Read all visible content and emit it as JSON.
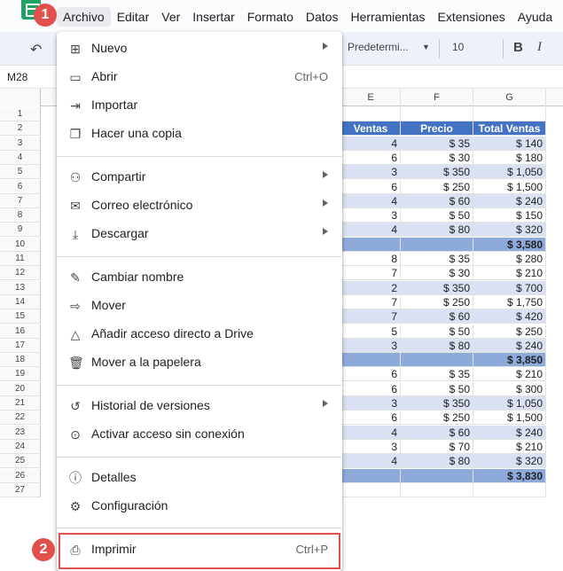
{
  "menubar": {
    "items": [
      "Archivo",
      "Editar",
      "Ver",
      "Insertar",
      "Formato",
      "Datos",
      "Herramientas",
      "Extensiones",
      "Ayuda"
    ]
  },
  "toolbar": {
    "font": "Predetermi...",
    "size": "10",
    "bold": "B",
    "italic": "I"
  },
  "formula_bar": {
    "cell_ref": "M28"
  },
  "grid": {
    "columns": [
      "E",
      "F",
      "G"
    ],
    "header": [
      "Ventas",
      "Precio",
      "Total Ventas"
    ],
    "rows": [
      {
        "n": "1",
        "e": "",
        "f": "",
        "g": "",
        "kind": "blank"
      },
      {
        "n": "2",
        "e": "Ventas",
        "f": "Precio",
        "g": "Total Ventas",
        "kind": "header"
      },
      {
        "n": "3",
        "e": "4",
        "f": "$ 35",
        "g": "$ 140",
        "kind": "band"
      },
      {
        "n": "4",
        "e": "6",
        "f": "$ 30",
        "g": "$ 180",
        "kind": "plain"
      },
      {
        "n": "5",
        "e": "3",
        "f": "$ 350",
        "g": "$ 1,050",
        "kind": "band"
      },
      {
        "n": "6",
        "e": "6",
        "f": "$ 250",
        "g": "$ 1,500",
        "kind": "plain"
      },
      {
        "n": "7",
        "e": "4",
        "f": "$ 60",
        "g": "$ 240",
        "kind": "band"
      },
      {
        "n": "8",
        "e": "3",
        "f": "$ 50",
        "g": "$ 150",
        "kind": "plain"
      },
      {
        "n": "9",
        "e": "4",
        "f": "$ 80",
        "g": "$ 320",
        "kind": "band"
      },
      {
        "n": "10",
        "e": "",
        "f": "",
        "g": "$ 3,580",
        "kind": "total"
      },
      {
        "n": "11",
        "e": "8",
        "f": "$ 35",
        "g": "$ 280",
        "kind": "plain"
      },
      {
        "n": "12",
        "e": "7",
        "f": "$ 30",
        "g": "$ 210",
        "kind": "plain"
      },
      {
        "n": "13",
        "e": "2",
        "f": "$ 350",
        "g": "$ 700",
        "kind": "band"
      },
      {
        "n": "14",
        "e": "7",
        "f": "$ 250",
        "g": "$ 1,750",
        "kind": "plain"
      },
      {
        "n": "15",
        "e": "7",
        "f": "$ 60",
        "g": "$ 420",
        "kind": "band"
      },
      {
        "n": "16",
        "e": "5",
        "f": "$ 50",
        "g": "$ 250",
        "kind": "plain"
      },
      {
        "n": "17",
        "e": "3",
        "f": "$ 80",
        "g": "$ 240",
        "kind": "band"
      },
      {
        "n": "18",
        "e": "",
        "f": "",
        "g": "$ 3,850",
        "kind": "total"
      },
      {
        "n": "19",
        "e": "6",
        "f": "$ 35",
        "g": "$ 210",
        "kind": "plain"
      },
      {
        "n": "20",
        "e": "6",
        "f": "$ 50",
        "g": "$ 300",
        "kind": "plain"
      },
      {
        "n": "21",
        "e": "3",
        "f": "$ 350",
        "g": "$ 1,050",
        "kind": "band"
      },
      {
        "n": "22",
        "e": "6",
        "f": "$ 250",
        "g": "$ 1,500",
        "kind": "plain"
      },
      {
        "n": "23",
        "e": "4",
        "f": "$ 60",
        "g": "$ 240",
        "kind": "band"
      },
      {
        "n": "24",
        "e": "3",
        "f": "$ 70",
        "g": "$ 210",
        "kind": "plain"
      },
      {
        "n": "25",
        "e": "4",
        "f": "$ 80",
        "g": "$ 320",
        "kind": "band"
      },
      {
        "n": "26",
        "e": "",
        "f": "",
        "g": "$ 3,830",
        "kind": "total"
      },
      {
        "n": "27",
        "e": "",
        "f": "",
        "g": "",
        "kind": "blank"
      }
    ]
  },
  "dropdown": {
    "items": [
      {
        "label": "Nuevo",
        "icon": "plus-square-icon",
        "glyph": "⊞",
        "submenu": true,
        "shortcut": ""
      },
      {
        "label": "Abrir",
        "icon": "folder-icon",
        "glyph": "▭",
        "submenu": false,
        "shortcut": "Ctrl+O"
      },
      {
        "label": "Importar",
        "icon": "import-icon",
        "glyph": "⇥",
        "submenu": false,
        "shortcut": ""
      },
      {
        "label": "Hacer una copia",
        "icon": "copy-icon",
        "glyph": "❐",
        "submenu": false,
        "shortcut": ""
      },
      {
        "label": "Compartir",
        "icon": "person-add-icon",
        "glyph": "⚇",
        "submenu": true,
        "shortcut": ""
      },
      {
        "label": "Correo electrónico",
        "icon": "mail-icon",
        "glyph": "✉",
        "submenu": true,
        "shortcut": ""
      },
      {
        "label": "Descargar",
        "icon": "download-icon",
        "glyph": "⤓",
        "submenu": true,
        "shortcut": ""
      },
      {
        "label": "Cambiar nombre",
        "icon": "rename-icon",
        "glyph": "✎",
        "submenu": false,
        "shortcut": ""
      },
      {
        "label": "Mover",
        "icon": "move-icon",
        "glyph": "⇨",
        "submenu": false,
        "shortcut": ""
      },
      {
        "label": "Añadir acceso directo a Drive",
        "icon": "drive-shortcut-icon",
        "glyph": "△",
        "submenu": false,
        "shortcut": ""
      },
      {
        "label": "Mover a la papelera",
        "icon": "trash-icon",
        "glyph": "🗑",
        "submenu": false,
        "shortcut": ""
      },
      {
        "label": "Historial de versiones",
        "icon": "history-icon",
        "glyph": "↺",
        "submenu": true,
        "shortcut": ""
      },
      {
        "label": "Activar acceso sin conexión",
        "icon": "offline-icon",
        "glyph": "⊙",
        "submenu": false,
        "shortcut": ""
      },
      {
        "label": "Detalles",
        "icon": "info-icon",
        "glyph": "ⓘ",
        "submenu": false,
        "shortcut": ""
      },
      {
        "label": "Configuración",
        "icon": "gear-icon",
        "glyph": "⚙",
        "submenu": false,
        "shortcut": ""
      },
      {
        "label": "Imprimir",
        "icon": "print-icon",
        "glyph": "⎙",
        "submenu": false,
        "shortcut": "Ctrl+P"
      }
    ]
  },
  "annotations": {
    "badge1": "1",
    "badge2": "2"
  },
  "colors": {
    "header_blue": "#4472c4",
    "band": "#d9e1f2",
    "total": "#8eaadb",
    "highlight": "#e2504c"
  }
}
